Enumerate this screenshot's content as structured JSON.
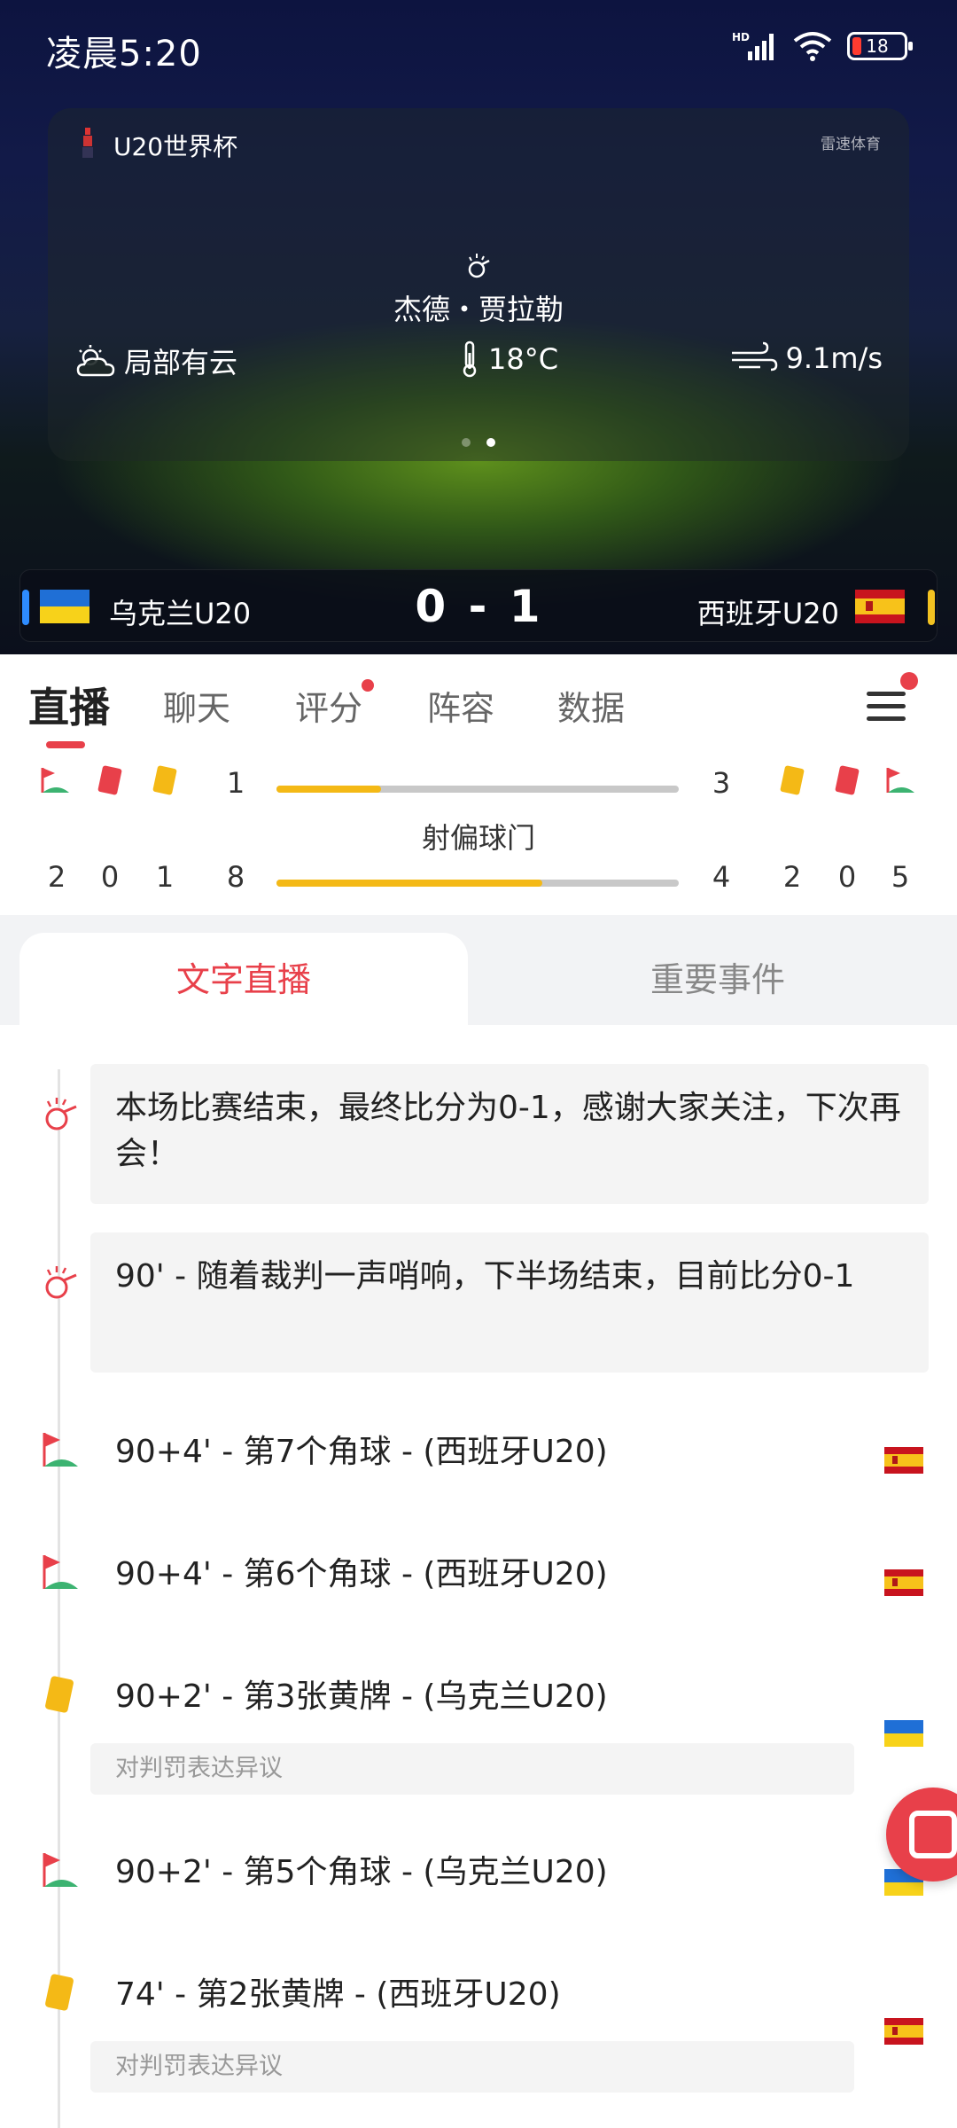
{
  "status": {
    "time": "凌晨5:20",
    "network": "HD",
    "battery": "18"
  },
  "match_header": {
    "competition": "U20世界杯",
    "brand": "雷速体育",
    "venue": "杰德・贾拉勒",
    "weather": "局部有云",
    "temperature": "18°C",
    "wind": "9.1m/s",
    "home_team": "乌克兰U20",
    "away_team": "西班牙U20",
    "score": "0 - 1",
    "colors": {
      "home": "#2e8cff",
      "away": "#f3c221"
    }
  },
  "tabs": [
    {
      "label": "直播",
      "active": true,
      "badge": false
    },
    {
      "label": "聊天",
      "active": false,
      "badge": false
    },
    {
      "label": "评分",
      "active": false,
      "badge": true
    },
    {
      "label": "阵容",
      "active": false,
      "badge": false
    },
    {
      "label": "数据",
      "active": false,
      "badge": false
    }
  ],
  "stats": {
    "row1": {
      "home_value": "1",
      "away_value": "3",
      "home_fraction": 0.26
    },
    "row2": {
      "label": "射偏球门",
      "home_corners": "2",
      "home_red": "0",
      "home_yellow": "1",
      "home_value": "8",
      "away_value": "4",
      "away_yellow": "2",
      "away_red": "0",
      "away_corners": "5",
      "home_fraction": 0.66
    }
  },
  "subtabs": {
    "active": "文字直播",
    "other": "重要事件"
  },
  "events": [
    {
      "icon": "whistle-icon",
      "text": "本场比赛结束，最终比分为0-1，感谢大家关注，下次再会！"
    },
    {
      "icon": "whistle-icon",
      "text": "90' - 随着裁判一声哨响，下半场结束，目前比分0-1"
    },
    {
      "icon": "corner-flag-icon",
      "text": "90+4' - 第7个角球 - (西班牙U20)",
      "team_flag": "spain"
    },
    {
      "icon": "corner-flag-icon",
      "text": "90+4' - 第6个角球 - (西班牙U20)",
      "team_flag": "spain"
    },
    {
      "icon": "yellow-card-icon",
      "text": "90+2' - 第3张黄牌 - (乌克兰U20)",
      "note": "对判罚表达异议",
      "team_flag": "ukraine"
    },
    {
      "icon": "corner-flag-icon",
      "text": "90+2' - 第5个角球 - (乌克兰U20)",
      "team_flag": "ukraine"
    },
    {
      "icon": "yellow-card-icon",
      "text": "74' - 第2张黄牌 - (西班牙U20)",
      "note": "对判罚表达异议",
      "team_flag": "spain"
    }
  ]
}
